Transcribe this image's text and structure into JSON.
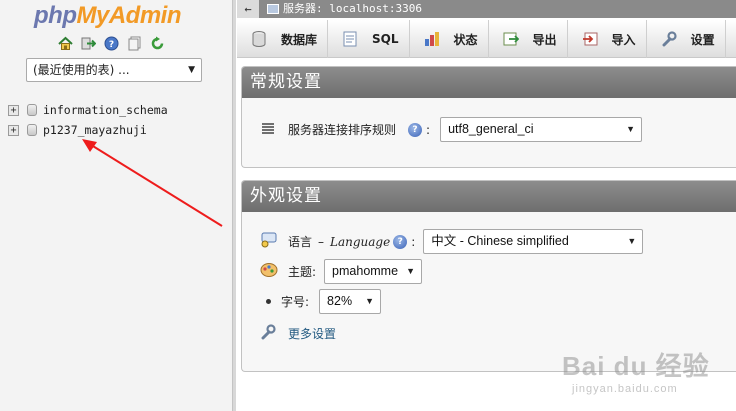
{
  "nav": {
    "logo_php": "php",
    "logo_myadmin": "MyAdmin",
    "icons": [
      "home-icon",
      "logout-icon",
      "help-icon",
      "docs-icon",
      "reload-icon"
    ],
    "recent_select": "(最近使用的表) ...",
    "databases": [
      {
        "name": "information_schema",
        "expander": "+"
      },
      {
        "name": "p1237_mayazhuji",
        "expander": "+"
      }
    ]
  },
  "topbar": {
    "collapse_glyph": "←",
    "server_text": "服务器: localhost:3306"
  },
  "tabs": [
    {
      "label": "数据库",
      "icon": "database-icon"
    },
    {
      "label": "SQL",
      "icon": "sql-icon"
    },
    {
      "label": "状态",
      "icon": "status-icon"
    },
    {
      "label": "导出",
      "icon": "export-icon"
    },
    {
      "label": "导入",
      "icon": "import-icon"
    },
    {
      "label": "设置",
      "icon": "settings-icon"
    }
  ],
  "general": {
    "title": "常规设置",
    "collation_label": "服务器连接排序规则",
    "colon": ":",
    "collation_value": "utf8_general_ci"
  },
  "appearance": {
    "title": "外观设置",
    "language_label": "语言",
    "language_dash": "–",
    "language_en": "Language",
    "colon": ":",
    "language_value": "中文 - Chinese simplified",
    "theme_label": "主题:",
    "theme_value": "pmahomme",
    "fontsize_label": "字号:",
    "fontsize_value": "82%",
    "more_settings": "更多设置"
  },
  "watermark": {
    "main": "Bai du 经验",
    "sub": "jingyan.baidu.com"
  },
  "colors": {
    "accent_red_arrow": "#ee1c1c",
    "panel_header": "#7d7d7d",
    "nav_bg": "#f3f3f3"
  }
}
